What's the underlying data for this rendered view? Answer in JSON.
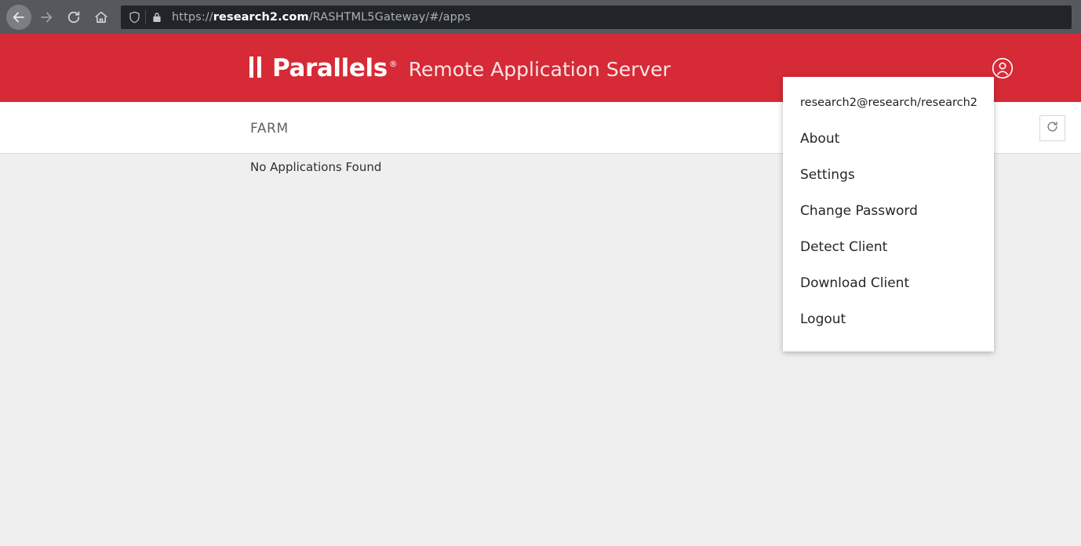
{
  "browser": {
    "nav": {
      "back_label": "Back",
      "forward_label": "Forward",
      "reload_label": "Reload",
      "home_label": "Home"
    },
    "url": {
      "scheme": "https://",
      "host": "research2.com",
      "path": "/RASHTML5Gateway/#/apps",
      "full": "https://research2.com/RASHTML5Gateway/#/apps"
    },
    "icons": {
      "shield": "shield-icon",
      "lock": "lock-icon",
      "back": "back-arrow-icon",
      "forward": "forward-arrow-icon",
      "reload": "reload-icon",
      "home": "home-icon"
    },
    "colors": {
      "toolbar": "#55595e",
      "urlbar": "#21252a",
      "url_text": "#a9b0b6",
      "url_host": "#ffffff"
    }
  },
  "header": {
    "brand_name": "Parallels",
    "brand_trademark": "®",
    "product_name": "Remote Application Server",
    "user_icon": "user-account-icon",
    "color": "#d62a36"
  },
  "subheader": {
    "title": "FARM",
    "refresh_icon": "refresh-icon"
  },
  "main": {
    "empty_message": "No Applications Found",
    "background": "#efefef"
  },
  "user_menu": {
    "account": "research2@research/research2",
    "items": [
      {
        "label": "About",
        "name": "menu-item-about"
      },
      {
        "label": "Settings",
        "name": "menu-item-settings"
      },
      {
        "label": "Change Password",
        "name": "menu-item-change-password"
      },
      {
        "label": "Detect Client",
        "name": "menu-item-detect-client"
      },
      {
        "label": "Download Client",
        "name": "menu-item-download-client"
      },
      {
        "label": "Logout",
        "name": "menu-item-logout"
      }
    ]
  }
}
